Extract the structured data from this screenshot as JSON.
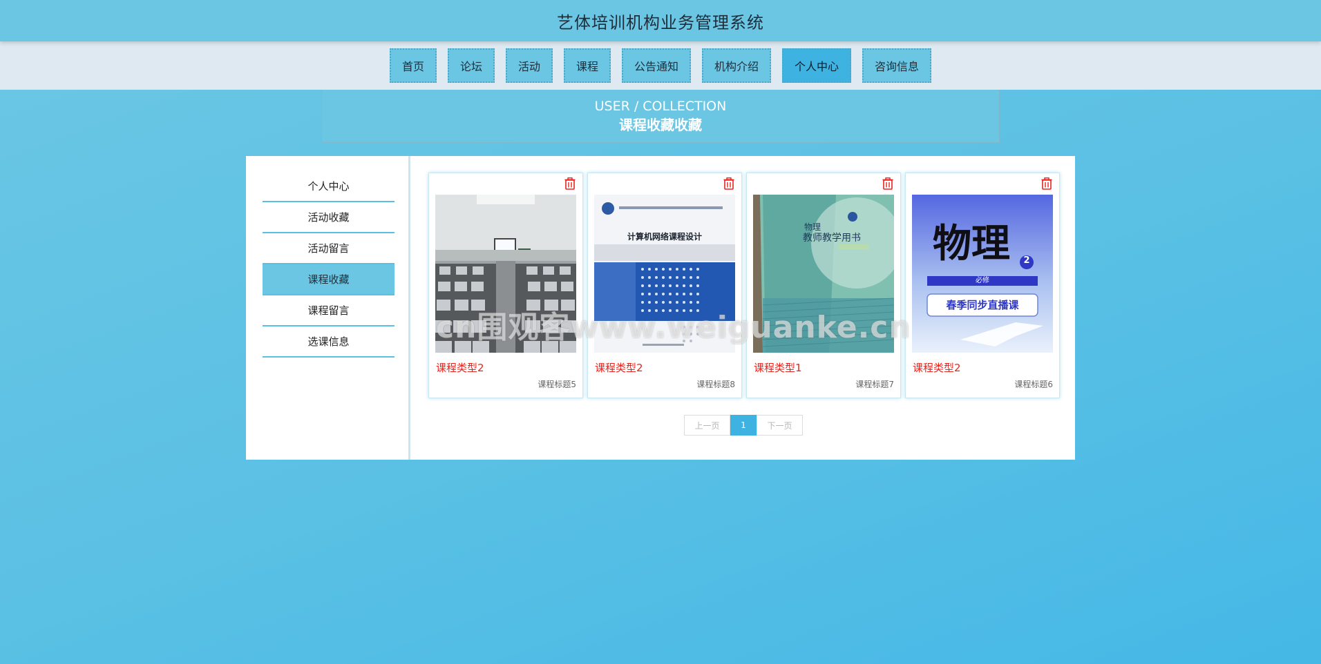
{
  "app": {
    "title": "艺体培训机构业务管理系统"
  },
  "nav": {
    "items": [
      {
        "label": "首页",
        "active": false
      },
      {
        "label": "论坛",
        "active": false
      },
      {
        "label": "活动",
        "active": false
      },
      {
        "label": "课程",
        "active": false
      },
      {
        "label": "公告通知",
        "active": false
      },
      {
        "label": "机构介绍",
        "active": false
      },
      {
        "label": "个人中心",
        "active": true
      },
      {
        "label": "咨询信息",
        "active": false
      }
    ]
  },
  "breadcrumb": {
    "en": "USER / COLLECTION",
    "cn": "课程收藏收藏"
  },
  "sidebar": {
    "items": [
      {
        "label": "个人中心",
        "active": false
      },
      {
        "label": "活动收藏",
        "active": false
      },
      {
        "label": "活动留言",
        "active": false
      },
      {
        "label": "课程收藏",
        "active": true
      },
      {
        "label": "课程留言",
        "active": false
      },
      {
        "label": "选课信息",
        "active": false
      }
    ]
  },
  "cards": [
    {
      "type": "课程类型2",
      "title": "课程标题5",
      "image": "classroom-photo"
    },
    {
      "type": "课程类型2",
      "title": "课程标题8",
      "image": "book-cover-network",
      "cover_text": "计算机网络课程设计"
    },
    {
      "type": "课程类型1",
      "title": "课程标题7",
      "image": "book-cover-physics-teacher",
      "cover_text": "教师教学用书",
      "cover_sub": "物理"
    },
    {
      "type": "课程类型2",
      "title": "课程标题6",
      "image": "book-cover-physics-2",
      "cover_text": "物理",
      "cover_badge": "2",
      "cover_band": "必修",
      "cover_pill": "春季同步直播课"
    }
  ],
  "pager": {
    "prev": "上一页",
    "current": "1",
    "next": "下一页"
  },
  "watermark": "cn围观客www.weiguanke.cn",
  "colors": {
    "accent": "#6ac6e3",
    "active": "#3eb2e1",
    "danger": "#e8231c"
  }
}
